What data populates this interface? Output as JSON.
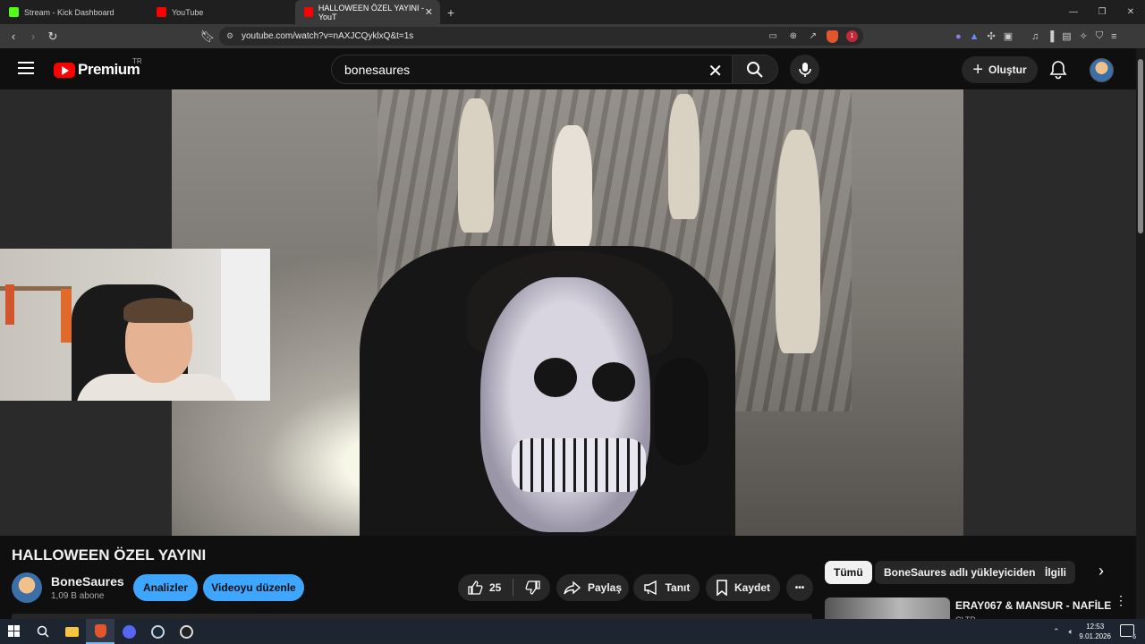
{
  "browser": {
    "tabs": [
      {
        "label": "Stream - Kick Dashboard",
        "favicon_color": "#53fc18"
      },
      {
        "label": "YouTube",
        "favicon_color": "#ff0000"
      },
      {
        "label": "HALLOWEEN ÖZEL YAYINI - YouT",
        "favicon_color": "#ff0000",
        "active": true
      }
    ],
    "new_tab": "+",
    "url": "youtube.com/watch?v=nAXJCQyklxQ&t=1s",
    "shield_badge": "1"
  },
  "youtube": {
    "logo_text": "Premium",
    "logo_region": "TR",
    "search_value": "bonesaures",
    "create_label": "Oluştur",
    "brand_color": "#ff0000",
    "accent_color": "#3ea6ff"
  },
  "video": {
    "title": "HALLOWEEN ÖZEL YAYINI",
    "channel_name": "BoneSaures",
    "subscribers": "1,09 B abone",
    "analytics_label": "Analizler",
    "edit_label": "Videoyu düzenle",
    "like_count": "25",
    "share_label": "Paylaş",
    "promote_label": "Tanıt",
    "save_label": "Kaydet",
    "more_label": "•••"
  },
  "sidebar": {
    "chips": [
      "Tümü",
      "BoneSaures adlı yükleyiciden",
      "İlgili"
    ],
    "recommendation": {
      "title": "ERAY067 & MANSUR - NAFİLE",
      "channel": "CLTP"
    }
  },
  "taskbar": {
    "time": "12:53",
    "date": "9.01.2026",
    "notifications": "6"
  }
}
